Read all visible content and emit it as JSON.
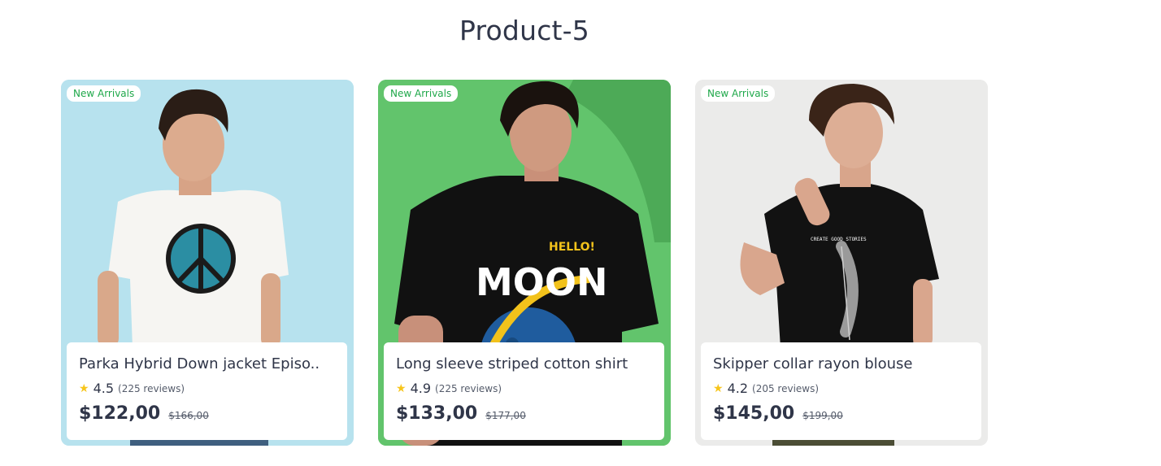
{
  "page": {
    "title": "Product-5"
  },
  "products": [
    {
      "badge": "New Arrivals",
      "name": "Parka Hybrid Down jacket Episo..",
      "rating": "4.5",
      "reviews": "(225 reviews)",
      "price": "$122,00",
      "old_price": "$166,00",
      "background": "#b7e2ee",
      "shirt": "#f6f5f2",
      "print": "peace-globe"
    },
    {
      "badge": "New Arrivals",
      "name": "Long sleeve striped cotton shirt",
      "rating": "4.9",
      "reviews": "(225 reviews)",
      "price": "$133,00",
      "old_price": "$177,00",
      "background": "#62c46c",
      "shirt": "#111111",
      "print": "moon-rocket"
    },
    {
      "badge": "New Arrivals",
      "name": "Skipper collar rayon blouse",
      "rating": "4.2",
      "reviews": "(205 reviews)",
      "price": "$145,00",
      "old_price": "$199,00",
      "background": "#ebebea",
      "shirt": "#121212",
      "print": "feather",
      "print_text": "CREATE GOOD STORIES"
    }
  ],
  "colors": {
    "badge_text": "#1fa84a",
    "star": "#f7c51b",
    "title": "#2f3548"
  },
  "icons": {
    "rating": "star-icon"
  }
}
